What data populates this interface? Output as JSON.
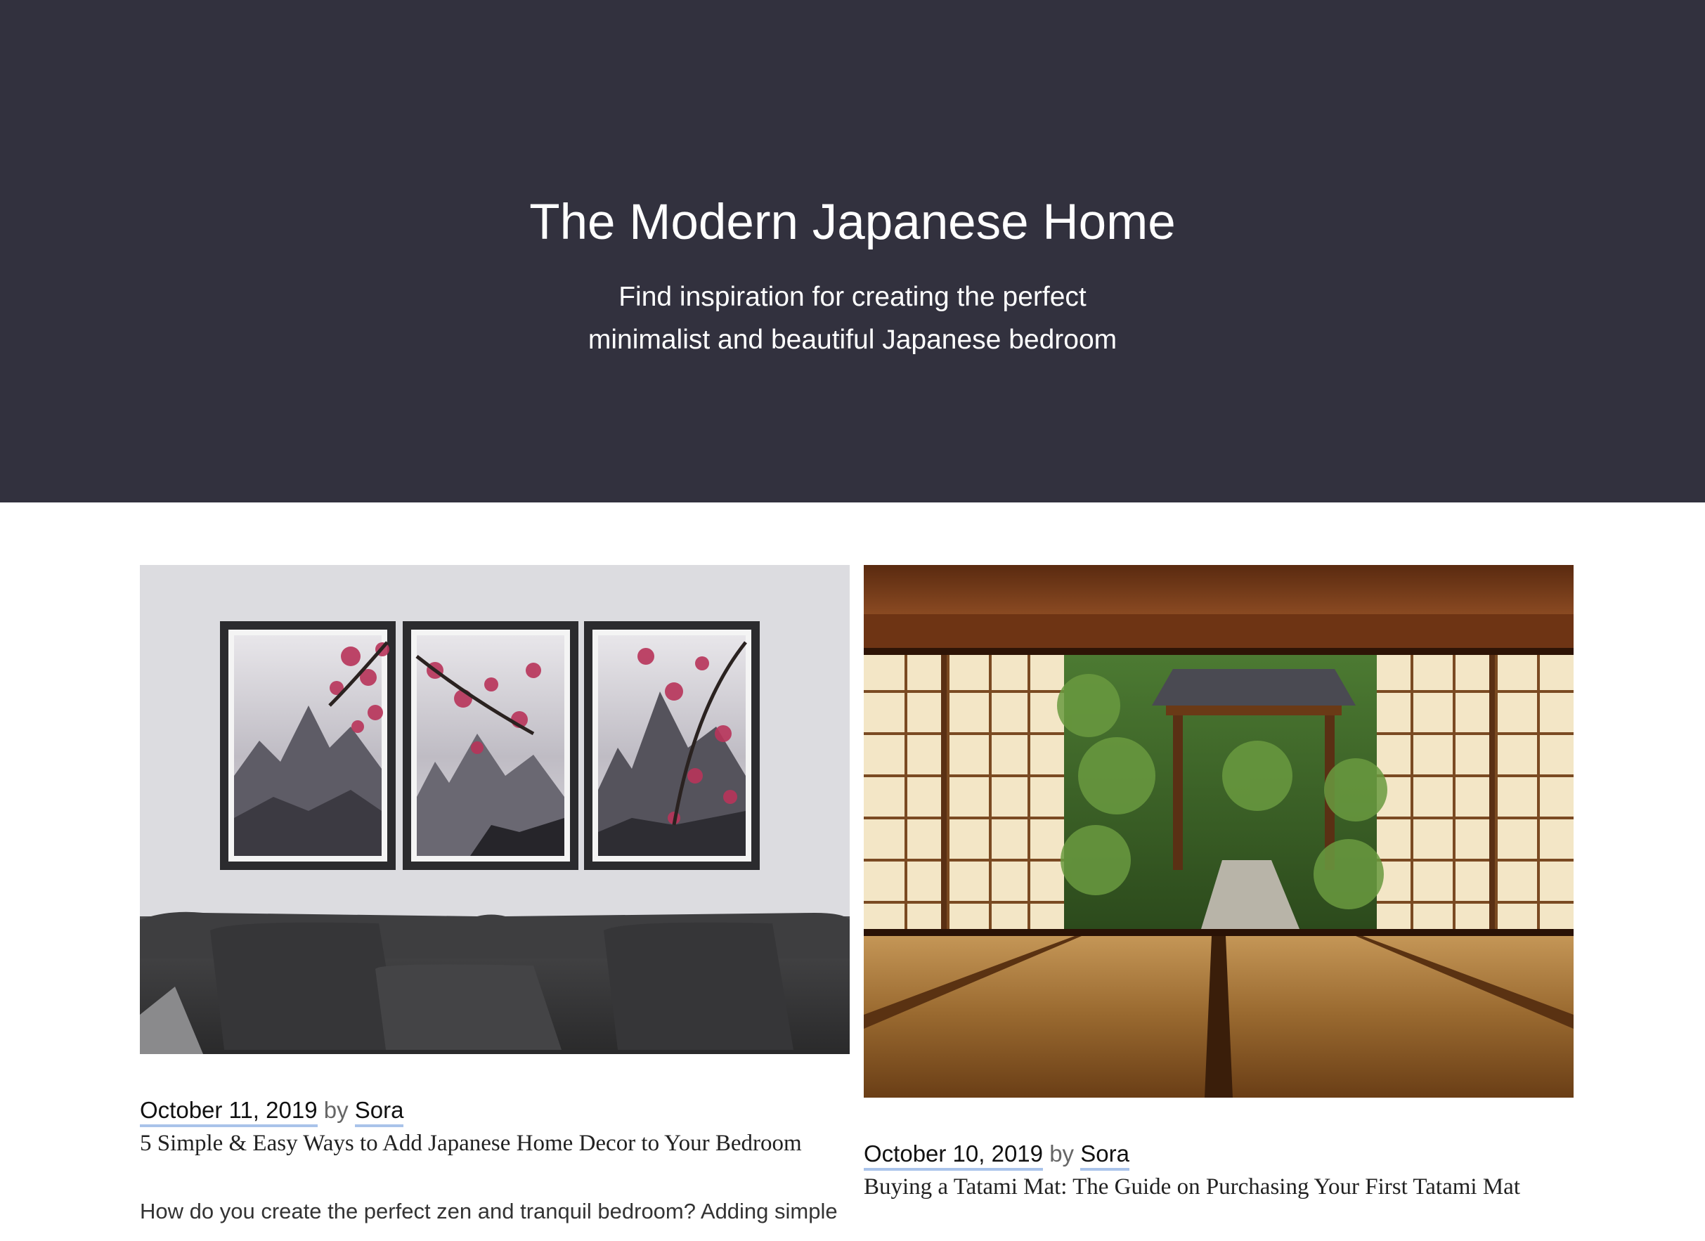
{
  "site": {
    "title": "The Modern Japanese Home",
    "tagline_line1": "Find inspiration for creating the perfect",
    "tagline_line2": "minimalist and beautiful Japanese bedroom"
  },
  "colors": {
    "hero_bg": "#32313e",
    "link_underline": "#a9c3ea"
  },
  "posts": [
    {
      "image": "cherry-blossom-triptych-above-sofa",
      "date": "October 11, 2019",
      "by": "by",
      "author": "Sora",
      "title": "5 Simple & Easy Ways to Add Japanese Home Decor to Your Bedroom",
      "excerpt": "How do you create the perfect zen and tranquil bedroom? Adding simple"
    },
    {
      "image": "tatami-room-with-open-shoji-to-garden",
      "date": "October 10, 2019",
      "by": "by",
      "author": "Sora",
      "title": "Buying a Tatami Mat: The Guide on Purchasing Your First Tatami Mat"
    }
  ]
}
